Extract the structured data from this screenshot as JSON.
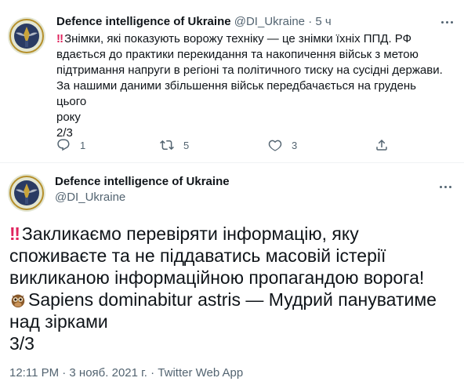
{
  "tweet1": {
    "author_name": "Defence intelligence of Ukraine",
    "handle": "@DI_Ukraine",
    "separator": "·",
    "time": "5 ч",
    "lines": [
      "Знімки, які показують ворожу техніку — це знімки їхніх ППД. РФ",
      "вдається до практики перекидання та накопичення військ з метою",
      "підтримання напруги в регіоні та політичного тиску на сусідні держави.",
      "За нашими даними збільшення військ передбачається на грудень цього",
      "року"
    ],
    "page_num": "2/3",
    "reply_count": "1",
    "retweet_count": "5",
    "like_count": "3"
  },
  "tweet2": {
    "author_name": "Defence intelligence of Ukraine",
    "handle": "@DI_Ukraine",
    "lines": [
      "Закликаємо перевіряти інформацію, яку",
      "споживаєте та не піддаватись масовій істерії",
      "викликаною інформаційною пропагандою ворога!",
      "Sapiens dominabitur astris — Мудрий пануватиме",
      "над зірками",
      "3/3"
    ],
    "timestamp": "12:11 PM · 3 нояб. 2021 г. · Twitter Web App"
  },
  "icons": {
    "emoji_double_exclamation": "‼",
    "emoji_owl": "owl-emoji",
    "reply": "reply-icon",
    "retweet": "retweet-icon",
    "like": "heart-icon",
    "share": "share-icon",
    "more": "more-icon"
  },
  "colors": {
    "text": "#0f1419",
    "secondary": "#536471",
    "emoji_red": "#e0245e",
    "divider": "#eff3f4"
  }
}
